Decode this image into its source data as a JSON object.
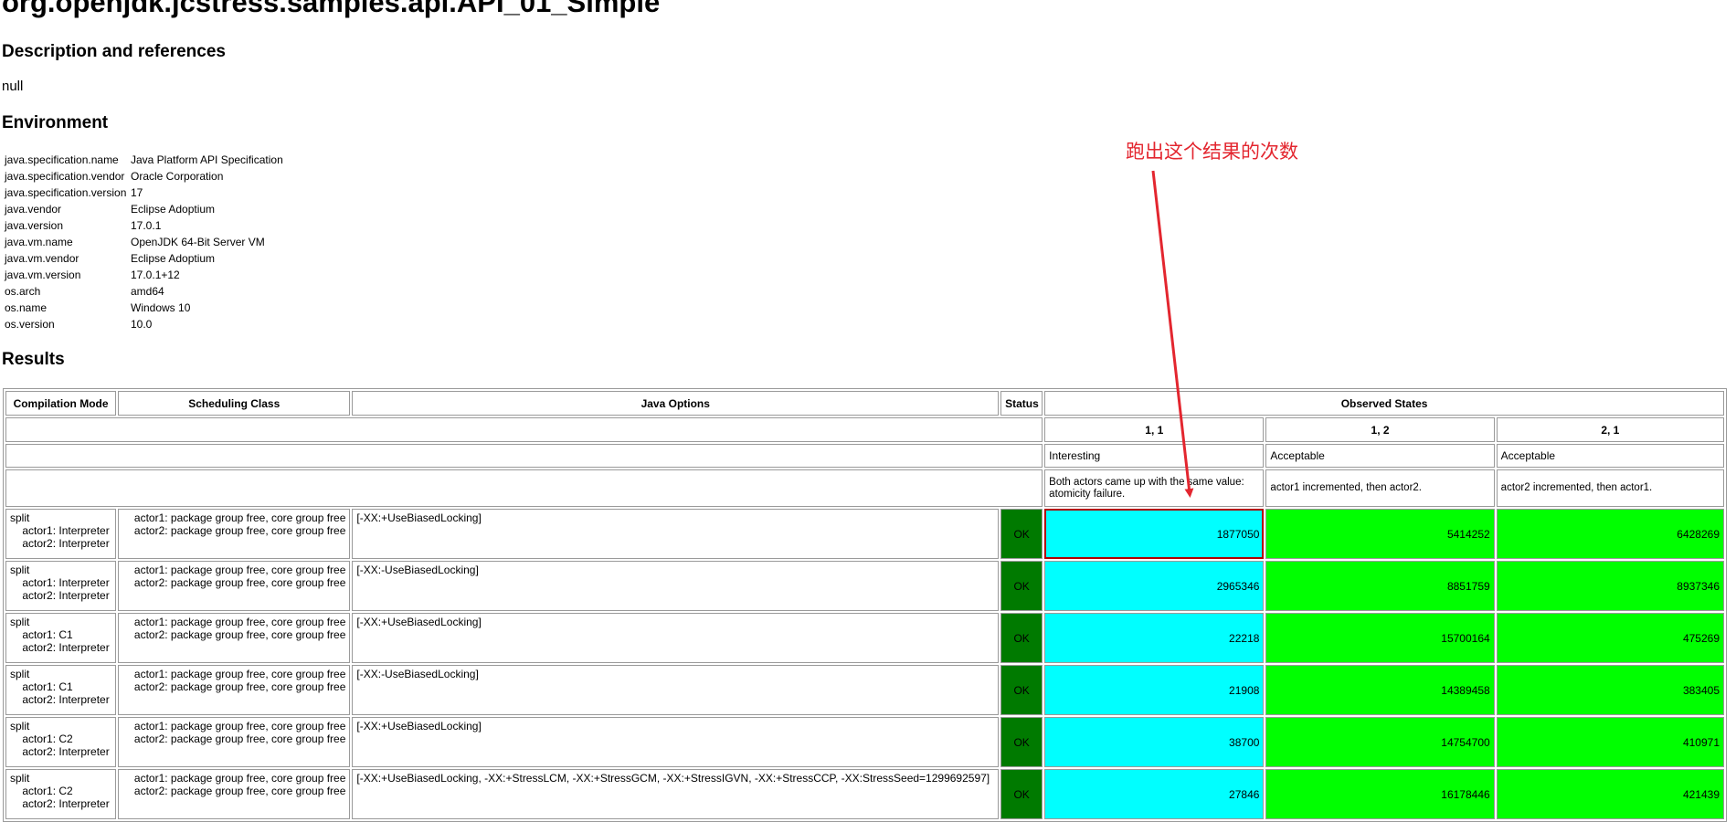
{
  "title": "org.openjdk.jcstress.samples.api.API_01_Simple",
  "headings": {
    "description": "Description and references",
    "environment": "Environment",
    "results": "Results"
  },
  "description_value": "null",
  "environment": [
    {
      "key": "java.specification.name",
      "value": "Java Platform API Specification"
    },
    {
      "key": "java.specification.vendor",
      "value": "Oracle Corporation"
    },
    {
      "key": "java.specification.version",
      "value": "17"
    },
    {
      "key": "java.vendor",
      "value": "Eclipse Adoptium"
    },
    {
      "key": "java.version",
      "value": "17.0.1"
    },
    {
      "key": "java.vm.name",
      "value": "OpenJDK 64-Bit Server VM"
    },
    {
      "key": "java.vm.vendor",
      "value": "Eclipse Adoptium"
    },
    {
      "key": "java.vm.version",
      "value": "17.0.1+12"
    },
    {
      "key": "os.arch",
      "value": "amd64"
    },
    {
      "key": "os.name",
      "value": "Windows 10"
    },
    {
      "key": "os.version",
      "value": "10.0"
    }
  ],
  "results": {
    "headers": [
      "Compilation Mode",
      "Scheduling Class",
      "Java Options",
      "Status",
      "Observed States"
    ],
    "states": [
      {
        "label": "1, 1",
        "expect": "Interesting",
        "desc": "Both actors came up with the same value: atomicity failure.",
        "color": "#00ffff"
      },
      {
        "label": "1, 2",
        "expect": "Acceptable",
        "desc": "actor1 incremented, then actor2.",
        "color": "#00ff00"
      },
      {
        "label": "2, 1",
        "expect": "Acceptable",
        "desc": "actor2 incremented, then actor1.",
        "color": "#00ff00"
      }
    ],
    "status_color": "#007a00",
    "rows": [
      {
        "mode": "split\n    actor1: Interpreter\n    actor2: Interpreter",
        "sched": "actor1: package group free, core group free\nactor2: package group free, core group free",
        "opts": "[-XX:+UseBiasedLocking]",
        "status": "OK",
        "counts": [
          "1877050",
          "5414252",
          "6428269"
        ]
      },
      {
        "mode": "split\n    actor1: Interpreter\n    actor2: Interpreter",
        "sched": "actor1: package group free, core group free\nactor2: package group free, core group free",
        "opts": "[-XX:-UseBiasedLocking]",
        "status": "OK",
        "counts": [
          "2965346",
          "8851759",
          "8937346"
        ]
      },
      {
        "mode": "split\n    actor1: C1\n    actor2: Interpreter",
        "sched": "actor1: package group free, core group free\nactor2: package group free, core group free",
        "opts": "[-XX:+UseBiasedLocking]",
        "status": "OK",
        "counts": [
          "22218",
          "15700164",
          "475269"
        ]
      },
      {
        "mode": "split\n    actor1: C1\n    actor2: Interpreter",
        "sched": "actor1: package group free, core group free\nactor2: package group free, core group free",
        "opts": "[-XX:-UseBiasedLocking]",
        "status": "OK",
        "counts": [
          "21908",
          "14389458",
          "383405"
        ]
      },
      {
        "mode": "split\n    actor1: C2\n    actor2: Interpreter",
        "sched": "actor1: package group free, core group free\nactor2: package group free, core group free",
        "opts": "[-XX:+UseBiasedLocking]",
        "status": "OK",
        "counts": [
          "38700",
          "14754700",
          "410971"
        ]
      },
      {
        "mode": "split\n    actor1: C2\n    actor2: Interpreter",
        "sched": "actor1: package group free, core group free\nactor2: package group free, core group free",
        "opts": "[-XX:+UseBiasedLocking, -XX:+StressLCM, -XX:+StressGCM, -XX:+StressIGVN, -XX:+StressCCP, -XX:StressSeed=1299692597]",
        "status": "OK",
        "counts": [
          "27846",
          "16178446",
          "421439"
        ]
      }
    ]
  },
  "annotation": {
    "text": "跑出这个结果的次数",
    "color": "#e3262f"
  }
}
